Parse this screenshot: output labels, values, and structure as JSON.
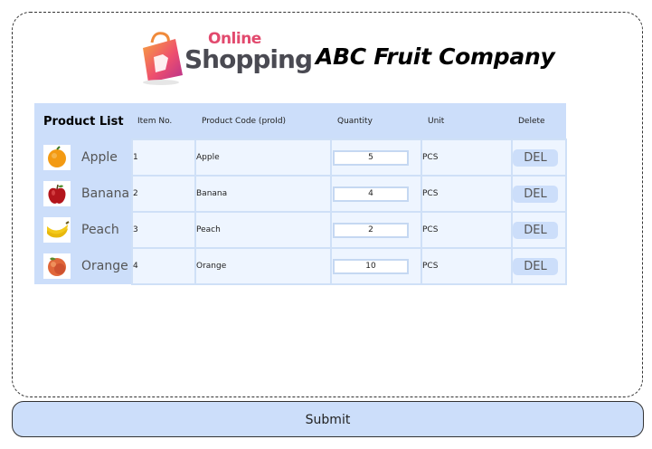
{
  "header": {
    "logo_online": "Online",
    "logo_shopping": "Shopping",
    "company_name": "ABC Fruit Company"
  },
  "table": {
    "headers": {
      "product_list": "Product List",
      "item_no": "Item No.",
      "product_code": "Product Code (proId)",
      "quantity": "Quantity",
      "unit": "Unit",
      "delete": "Delete"
    },
    "rows": [
      {
        "name": "Apple",
        "image_icon": "orange-icon",
        "item_no": "1",
        "code": "Apple",
        "quantity": "5",
        "unit": "PCS",
        "del": "DEL"
      },
      {
        "name": "Banana",
        "image_icon": "apple-icon",
        "item_no": "2",
        "code": "Banana",
        "quantity": "4",
        "unit": "PCS",
        "del": "DEL"
      },
      {
        "name": "Peach",
        "image_icon": "banana-icon",
        "item_no": "3",
        "code": "Peach",
        "quantity": "2",
        "unit": "PCS",
        "del": "DEL"
      },
      {
        "name": "Orange",
        "image_icon": "peach-icon",
        "item_no": "4",
        "code": "Orange",
        "quantity": "10",
        "unit": "PCS",
        "del": "DEL"
      }
    ]
  },
  "submit_label": "Submit",
  "colors": {
    "header_bg": "#ccdefa",
    "cell_bg": "#eef5ff",
    "logo_pink": "#e24a6e",
    "logo_dark": "#4a4a52"
  }
}
